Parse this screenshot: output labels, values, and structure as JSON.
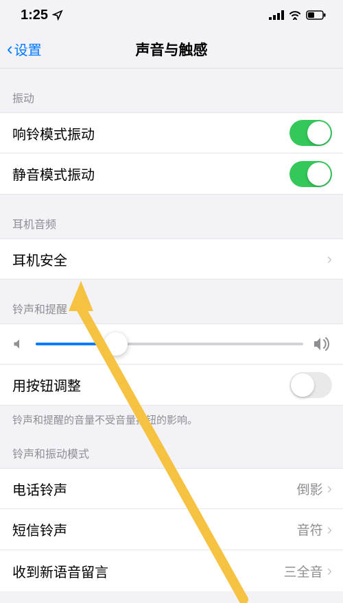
{
  "status": {
    "time": "1:25"
  },
  "nav": {
    "back": "设置",
    "title": "声音与触感"
  },
  "sections": {
    "vibration": {
      "header": "振动",
      "ring_vibrate": "响铃模式振动",
      "silent_vibrate": "静音模式振动",
      "ring_on": true,
      "silent_on": true
    },
    "headphone_audio": {
      "header": "耳机音频",
      "safety": "耳机安全"
    },
    "ringer_alerts": {
      "header": "铃声和提醒",
      "slider_percent": 30,
      "button_adjust": "用按钮调整",
      "button_adjust_on": false,
      "footer": "铃声和提醒的音量不受音量按钮的影响。"
    },
    "sound_patterns": {
      "header": "铃声和振动模式",
      "ringtone_label": "电话铃声",
      "ringtone_value": "倒影",
      "text_label": "短信铃声",
      "text_value": "音符",
      "voicemail_label": "收到新语音留言",
      "voicemail_value": "三全音"
    }
  }
}
